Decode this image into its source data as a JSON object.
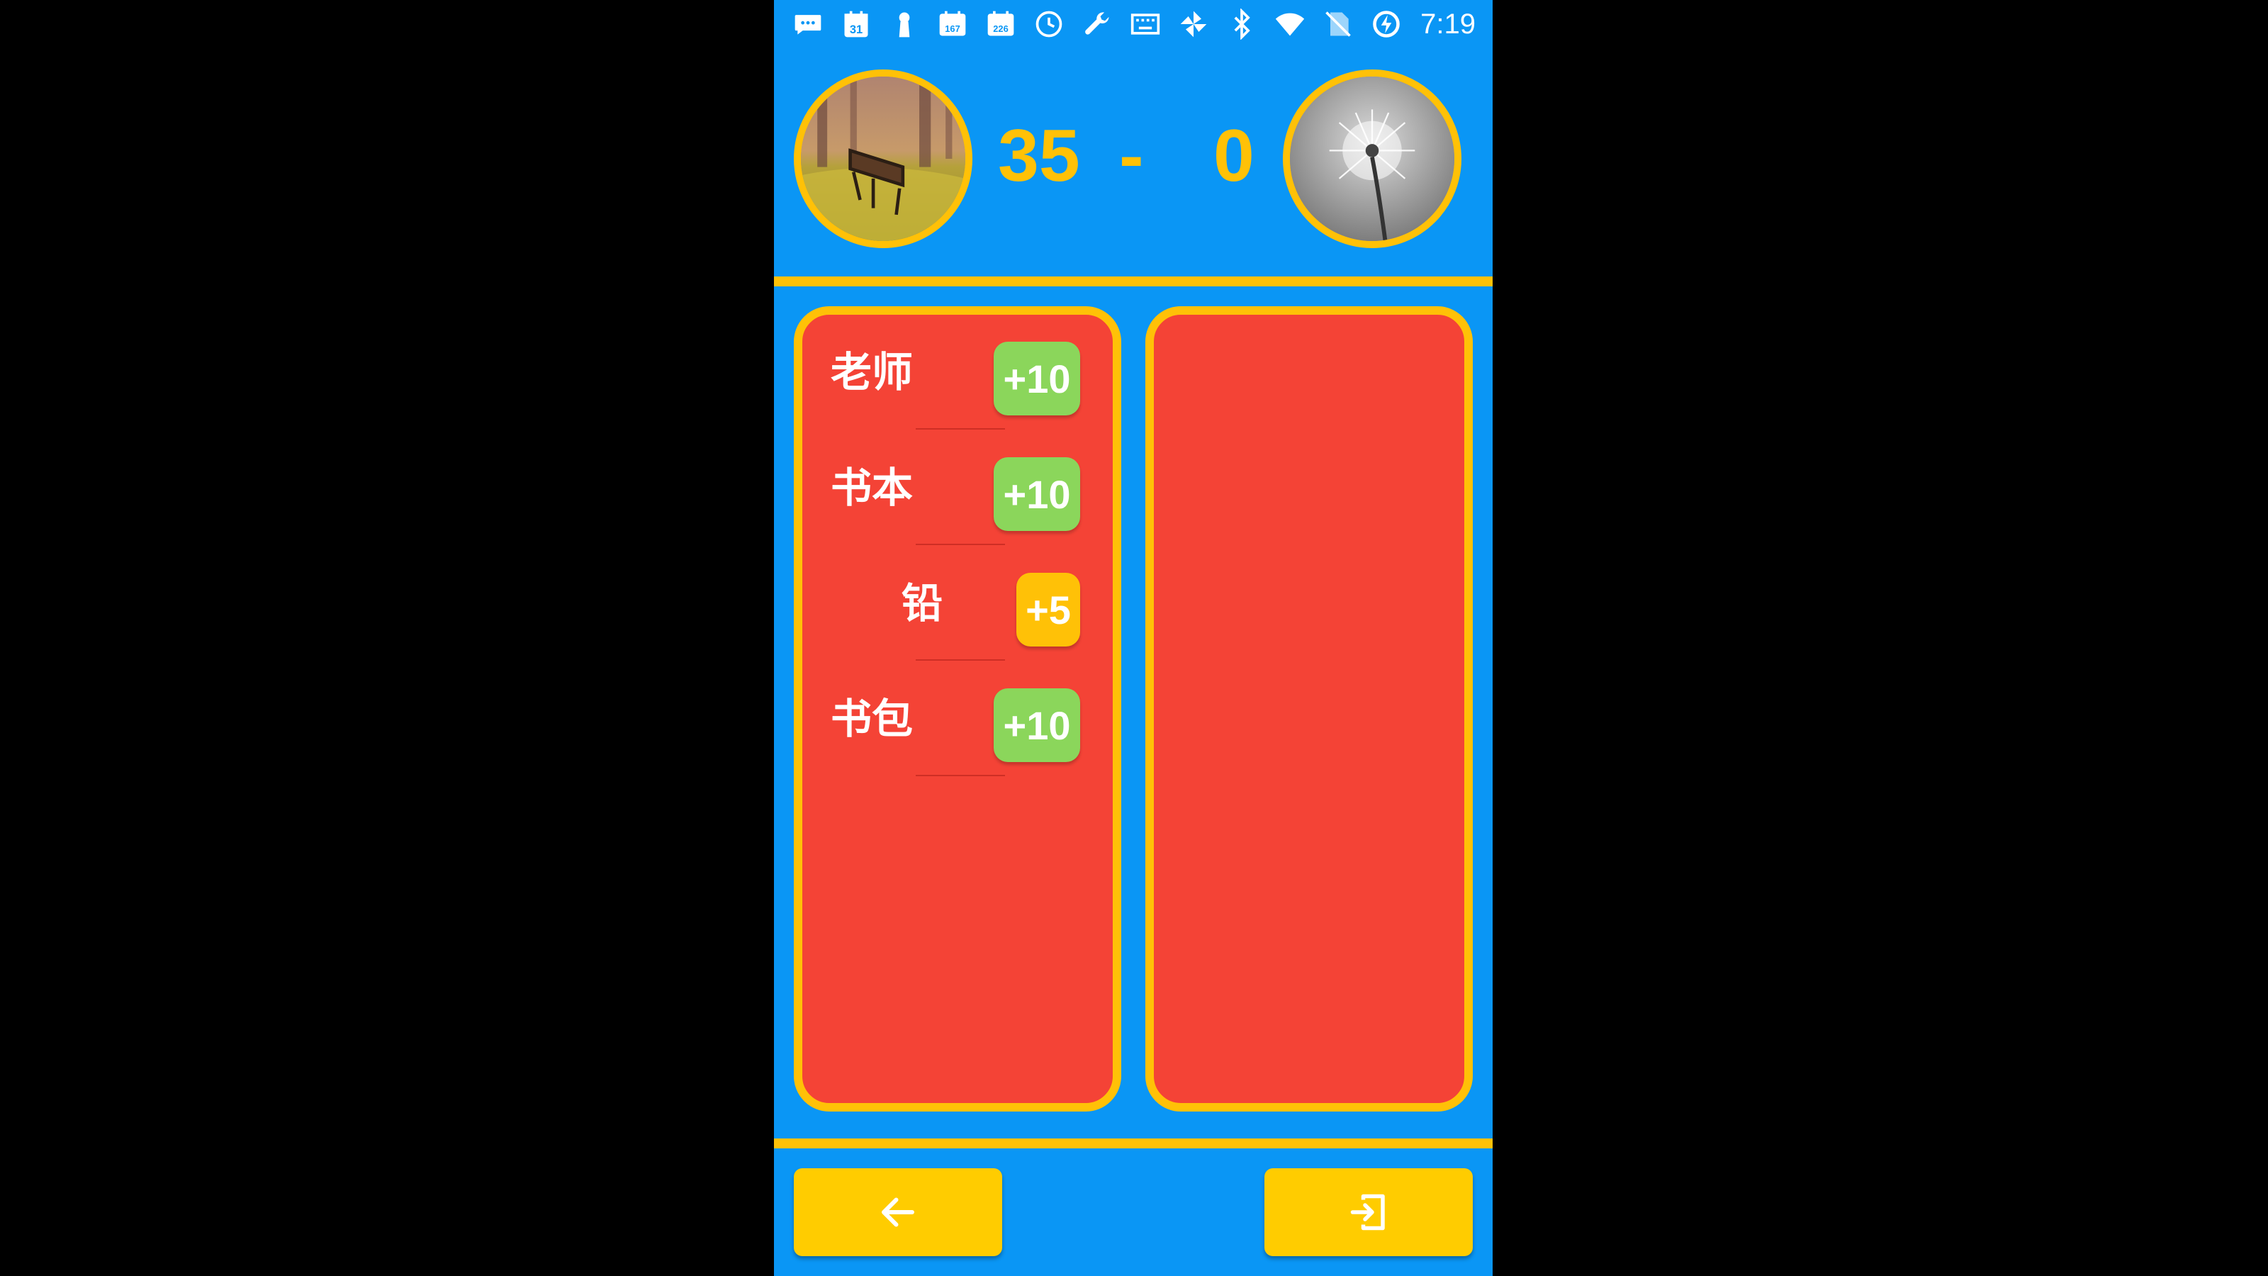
{
  "status_bar": {
    "time": "7:19",
    "left_icons": [
      "chat-icon",
      "calendar-icon",
      "keyhole-icon",
      "calendar-167-icon",
      "calendar-226-icon",
      "clock-icon",
      "wrench-icon",
      "keyboard-icon",
      "pinwheel-icon"
    ],
    "calendar_day": "31",
    "badge_167": "167",
    "badge_226": "226",
    "right_icons": [
      "bluetooth-icon",
      "wifi-icon",
      "no-sim-icon",
      "battery-charging-icon"
    ]
  },
  "scoreboard": {
    "player_score": "35",
    "separator": "-",
    "opponent_score": "0"
  },
  "player_words": [
    {
      "word": "老师",
      "points": "+10",
      "color": "#8bd65b"
    },
    {
      "word": "书本",
      "points": "+10",
      "color": "#8bd65b"
    },
    {
      "word": "铅",
      "points": "+5",
      "color": "#ffc107"
    },
    {
      "word": "书包",
      "points": "+10",
      "color": "#8bd65b"
    }
  ],
  "opponent_words": [],
  "colors": {
    "background": "#0a96f5",
    "accent": "#ffc107",
    "panel": "#f44336"
  },
  "buttons": {
    "back_icon": "arrow-left-icon",
    "exit_icon": "exit-icon"
  }
}
